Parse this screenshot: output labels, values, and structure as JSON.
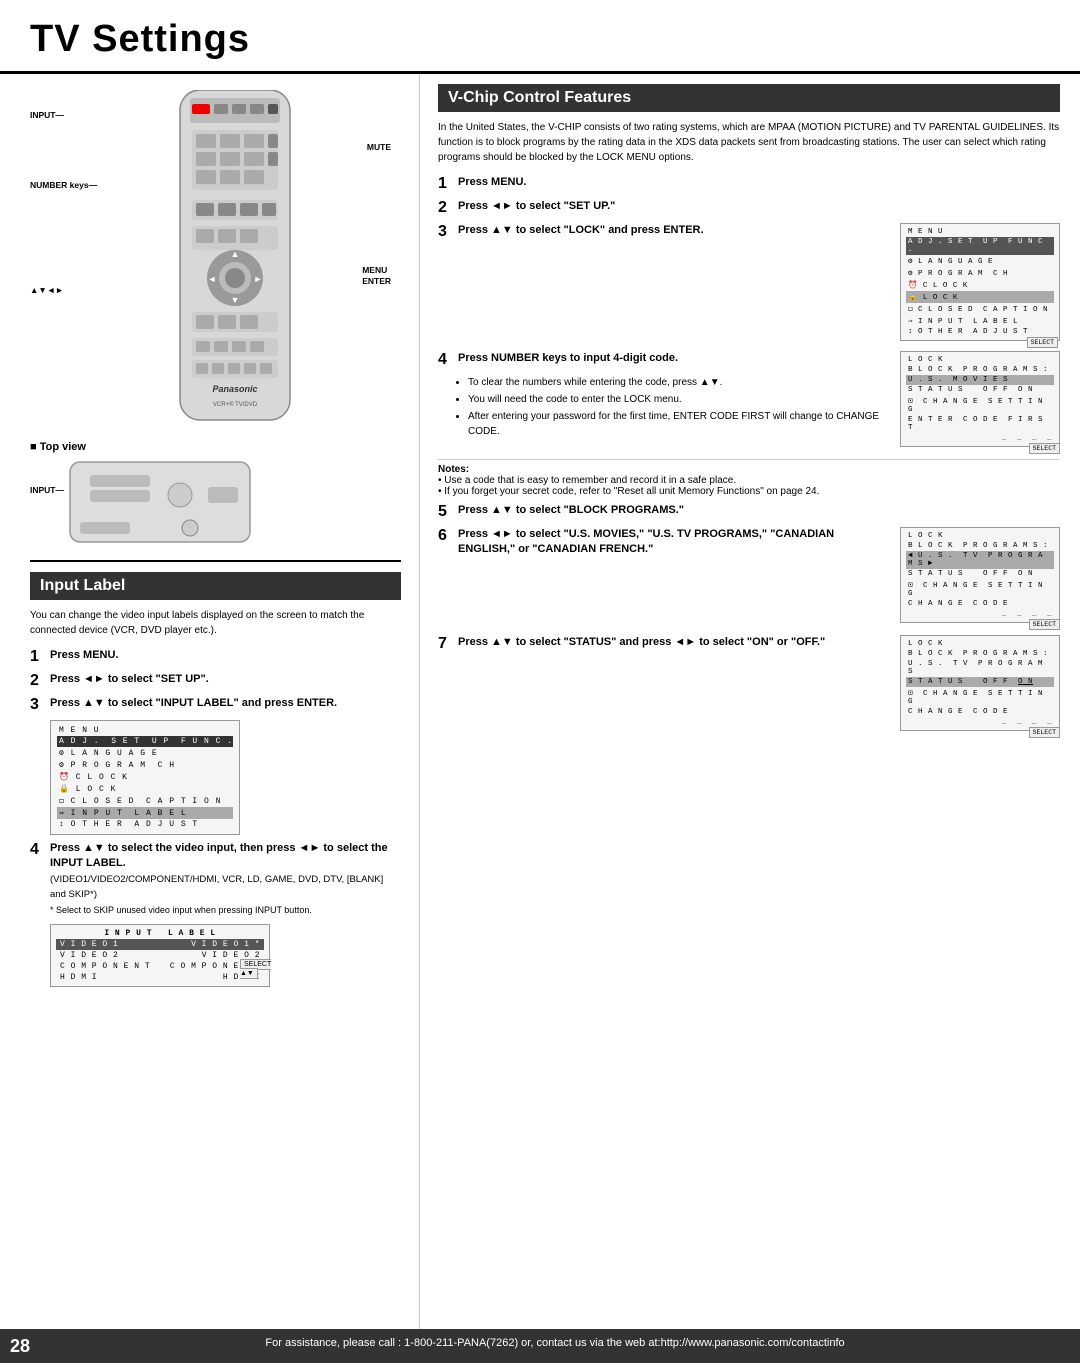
{
  "page": {
    "title": "TV Settings",
    "number": "28",
    "footer": "For assistance, please call : 1-800-211-PANA(7262) or, contact us via the web at:http://www.panasonic.com/contactinfo"
  },
  "input_label_section": {
    "header": "Input Label",
    "intro": "You can change the video input labels displayed on the screen to match the connected device (VCR, DVD player etc.).",
    "steps": [
      {
        "num": "1",
        "text": "Press MENU."
      },
      {
        "num": "2",
        "text": "Press ◄► to select \"SET UP\"."
      },
      {
        "num": "3",
        "text": "Press ▲▼ to select \"INPUT LABEL\" and press ENTER."
      },
      {
        "num": "4",
        "text": "Press ▲▼ to select the video input, then press ◄► to select the INPUT LABEL.",
        "sub": "(VIDEO1/VIDEO2/COMPONENT/HDMI, VCR, LD, GAME, DVD, DTV, [BLANK] and SKIP*)\n* Select to SKIP unused video input when pressing INPUT button."
      }
    ],
    "menu_screen": {
      "rows": [
        {
          "text": "M E N U",
          "style": "normal"
        },
        {
          "text": "A D J .  S E T  U P  F U N C .",
          "style": "highlight"
        },
        {
          "text": "⚙ L A N G U A G E",
          "style": "normal"
        },
        {
          "text": "⚙ P R O G R A M  C H",
          "style": "normal"
        },
        {
          "text": "⏰ C L O C K",
          "style": "normal"
        },
        {
          "text": "🔒 L O C K",
          "style": "normal"
        },
        {
          "text": "◻ C L O S E D  C A P T I O N",
          "style": "normal"
        },
        {
          "text": "⇒ I N P U T  L A B E L",
          "style": "selected"
        },
        {
          "text": "↕ O T H E R  A D J U S T",
          "style": "normal"
        }
      ]
    },
    "input_label_screen": {
      "rows": [
        {
          "left": "V I D E O 1",
          "right": "V I D E O 1 *"
        },
        {
          "left": "V I D E O 2",
          "right": "V I D E O 2"
        },
        {
          "left": "C O M P O N E N T",
          "right": "C O M P O N E N T"
        },
        {
          "left": "H D M I",
          "right": "H D M I"
        }
      ]
    }
  },
  "remote": {
    "labels": {
      "input": "INPUT",
      "mute": "MUTE",
      "number_keys": "NUMBER keys",
      "menu_enter": "MENU\nENTER",
      "nav_arrows": "▲▼◄►",
      "top_view_label": "■ Top view",
      "top_input": "INPUT"
    },
    "brand": "Panasonic"
  },
  "vchip_section": {
    "header": "V-Chip Control Features",
    "intro": "In the United States, the V-CHIP consists of two rating systems, which are MPAA (MOTION PICTURE) and TV PARENTAL GUIDELINES. Its function is to block programs by the rating data in the XDS data packets sent from broadcasting stations. The user can select which rating programs should be blocked by the LOCK MENU options.",
    "steps": [
      {
        "num": "1",
        "text": "Press MENU."
      },
      {
        "num": "2",
        "text": "Press ◄► to select \"SET UP.\""
      },
      {
        "num": "3",
        "text": "Press ▲▼ to select \"LOCK\" and press ENTER."
      },
      {
        "num": "4",
        "text": "Press NUMBER keys to input 4-digit code.",
        "bullets": [
          "To clear the numbers while entering the code, press ▲▼.",
          "You will need the code to enter the LOCK menu.",
          "After entering your password for the first time, ENTER CODE FIRST will change to CHANGE CODE."
        ]
      },
      {
        "num": "5",
        "text": "Press ▲▼ to select \"BLOCK PROGRAMS.\""
      },
      {
        "num": "6",
        "text": "Press ◄► to select \"U.S. MOVIES,\" \"U.S. TV PROGRAMS,\" \"CANADIAN ENGLISH,\" or \"CANADIAN FRENCH.\""
      },
      {
        "num": "7",
        "text": "Press ▲▼ to select \"STATUS\" and press ◄► to select \"ON\" or \"OFF.\""
      }
    ],
    "menu_screen": {
      "rows": [
        {
          "text": "M E N U",
          "style": "normal"
        },
        {
          "text": "A D J .  S E T  U P  F U N C .",
          "style": "highlight"
        },
        {
          "text": "⚙ L A N G U A G E",
          "style": "normal"
        },
        {
          "text": "⚙ P R O G R A M  C H",
          "style": "normal"
        },
        {
          "text": "⏰ C L O C K",
          "style": "normal"
        },
        {
          "text": "🔒 L O C K",
          "style": "selected"
        },
        {
          "text": "◻ C L O S E D  C A P T I O N",
          "style": "normal"
        },
        {
          "text": "⇒ I N P U T  L A B E L",
          "style": "normal"
        },
        {
          "text": "↕ O T H E R  A D J U S T",
          "style": "normal"
        }
      ]
    },
    "lock_screen_1": {
      "rows": [
        {
          "text": "L O C K",
          "style": "header"
        },
        {
          "text": "B L O C K  P R O G R A M S :",
          "style": "normal"
        },
        {
          "text": "U . S .  M O V I E S",
          "style": "selected"
        },
        {
          "text": "S T A T U S     O F F  O N",
          "style": "normal"
        },
        {
          "text": "⊡  C H A N G E  S E T T I N G",
          "style": "normal"
        },
        {
          "text": "E N T E R  C O D E  F I R S T",
          "style": "normal"
        },
        {
          "text": "_ _ _ _",
          "style": "code"
        }
      ]
    },
    "lock_screen_2": {
      "rows": [
        {
          "text": "L O C K",
          "style": "header"
        },
        {
          "text": "B L O C K  P R O G R A M S :",
          "style": "normal"
        },
        {
          "text": "◄ U . S .  T V  P R O G R A M S ►",
          "style": "selected"
        },
        {
          "text": "S T A T U S     O F F  O N",
          "style": "normal"
        },
        {
          "text": "⊡  C H A N G E  S E T T I N G",
          "style": "normal"
        },
        {
          "text": "C H A N G E  C O D E",
          "style": "normal"
        },
        {
          "text": "_ _ _ _",
          "style": "code"
        }
      ]
    },
    "lock_screen_3": {
      "rows": [
        {
          "text": "L O C K",
          "style": "header"
        },
        {
          "text": "B L O C K  P R O G R A M S :",
          "style": "normal"
        },
        {
          "text": "U . S .  T V  P R O G R A M S",
          "style": "normal"
        },
        {
          "text": "S T A T U S     O F F  O N",
          "style": "selected-partial"
        },
        {
          "text": "⊡  C H A N G E  S E T T I N G",
          "style": "normal"
        },
        {
          "text": "C H A N G E  C O D E",
          "style": "normal"
        },
        {
          "text": "_ _ _ _",
          "style": "code"
        }
      ]
    },
    "notes": [
      "Use a code that is easy to remember and record it in a safe place.",
      "If you forget your secret code, refer to \"Reset all unit Memory Functions\" on page 24."
    ]
  }
}
